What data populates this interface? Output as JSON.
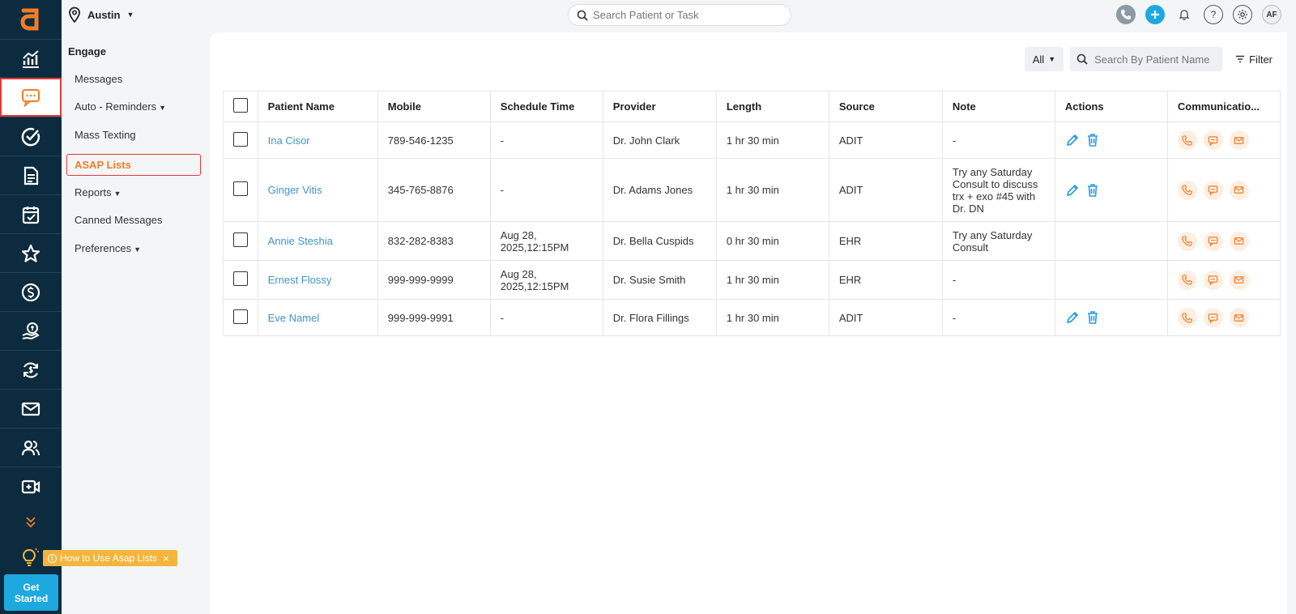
{
  "topbar": {
    "location": "Austin",
    "search_placeholder": "Search Patient or Task",
    "avatar": "AF"
  },
  "subnav": {
    "heading": "Engage",
    "items": [
      {
        "label": "Messages"
      },
      {
        "label": "Auto - Reminders"
      },
      {
        "label": "Mass Texting"
      },
      {
        "label": "ASAP Lists"
      },
      {
        "label": "Reports"
      },
      {
        "label": "Canned Messages"
      },
      {
        "label": "Preferences"
      }
    ]
  },
  "rail": {
    "tip": "How to Use Asap Lists",
    "get_started_1": "Get",
    "get_started_2": "Started"
  },
  "filters": {
    "all": "All",
    "search_placeholder": "Search By Patient Name",
    "filter": "Filter"
  },
  "table": {
    "headers": [
      "Patient Name",
      "Mobile",
      "Schedule Time",
      "Provider",
      "Length",
      "Source",
      "Note",
      "Actions",
      "Communicatio..."
    ],
    "rows": [
      {
        "name": "Ina Cisor",
        "mobile": "789-546-1235",
        "schedule": "-",
        "provider": "Dr. John Clark",
        "length": "1 hr 30 min",
        "source": "ADIT",
        "note": "-"
      },
      {
        "name": "Ginger Vitis",
        "mobile": "345-765-8876",
        "schedule": "-",
        "provider": "Dr. Adams Jones",
        "length": "1 hr 30 min",
        "source": "ADIT",
        "note": "Try any Saturday Consult to discuss trx + exo #45 with Dr. DN"
      },
      {
        "name": "Annie Steshia",
        "mobile": "832-282-8383",
        "schedule": "Aug 28, 2025,12:15PM",
        "provider": "Dr. Bella Cuspids",
        "length": "0 hr 30 min",
        "source": "EHR",
        "note": "Try any Saturday Consult"
      },
      {
        "name": "Ernest Flossy",
        "mobile": "999-999-9999",
        "schedule": "Aug 28, 2025,12:15PM",
        "provider": "Dr. Susie Smith",
        "length": "1 hr 30 min",
        "source": "EHR",
        "note": "-"
      },
      {
        "name": "Eve Namel",
        "mobile": "999-999-9991",
        "schedule": "-",
        "provider": "Dr. Flora Fillings",
        "length": "1 hr 30 min",
        "source": "ADIT",
        "note": "-"
      }
    ]
  },
  "colors": {
    "rail_bg": "#0d2b3e",
    "accent_orange": "#f07e26",
    "link_blue": "#3e95c9",
    "active_border": "#e53935"
  }
}
